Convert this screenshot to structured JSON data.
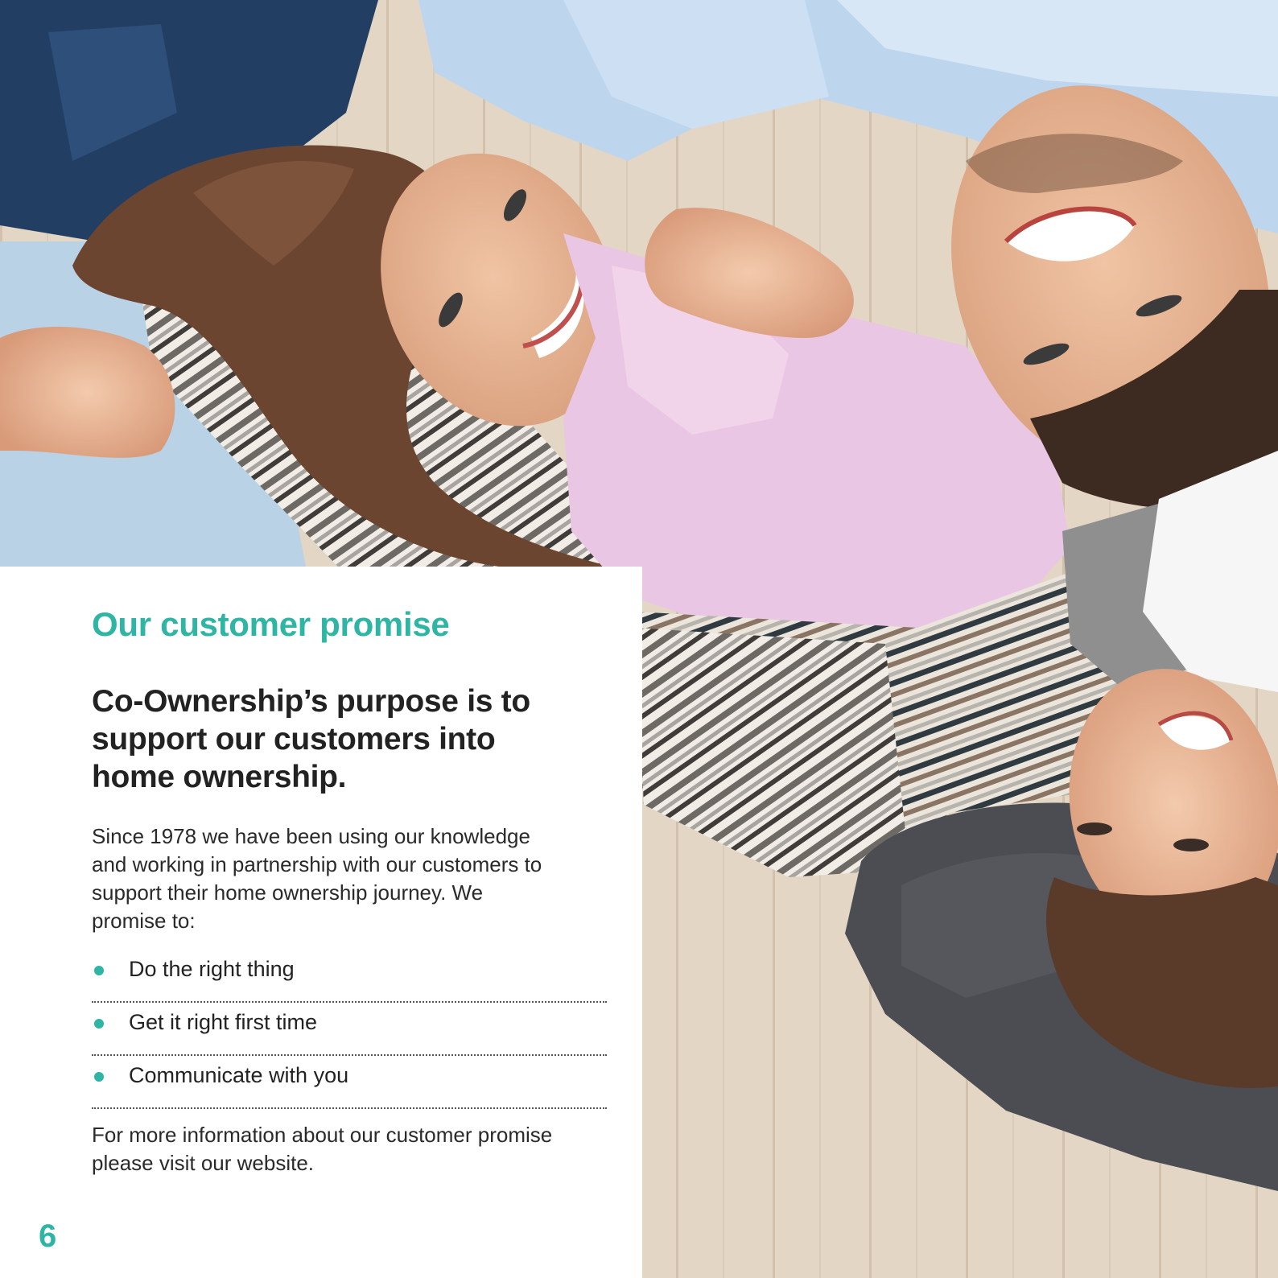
{
  "page": {
    "heading": "Our customer promise",
    "lead": "Co-Ownership’s purpose is to support our customers into home ownership.",
    "intro": "Since 1978 we have been using our knowledge and working in partnership with our customers to support their home ownership journey. We promise to:",
    "promises": [
      "Do the right thing",
      "Get it right first time",
      "Communicate with you"
    ],
    "closing": "For more information about our customer promise please visit our website.",
    "page_number": "6"
  },
  "colors": {
    "accent": "#2fb5a4",
    "text": "#222222"
  }
}
